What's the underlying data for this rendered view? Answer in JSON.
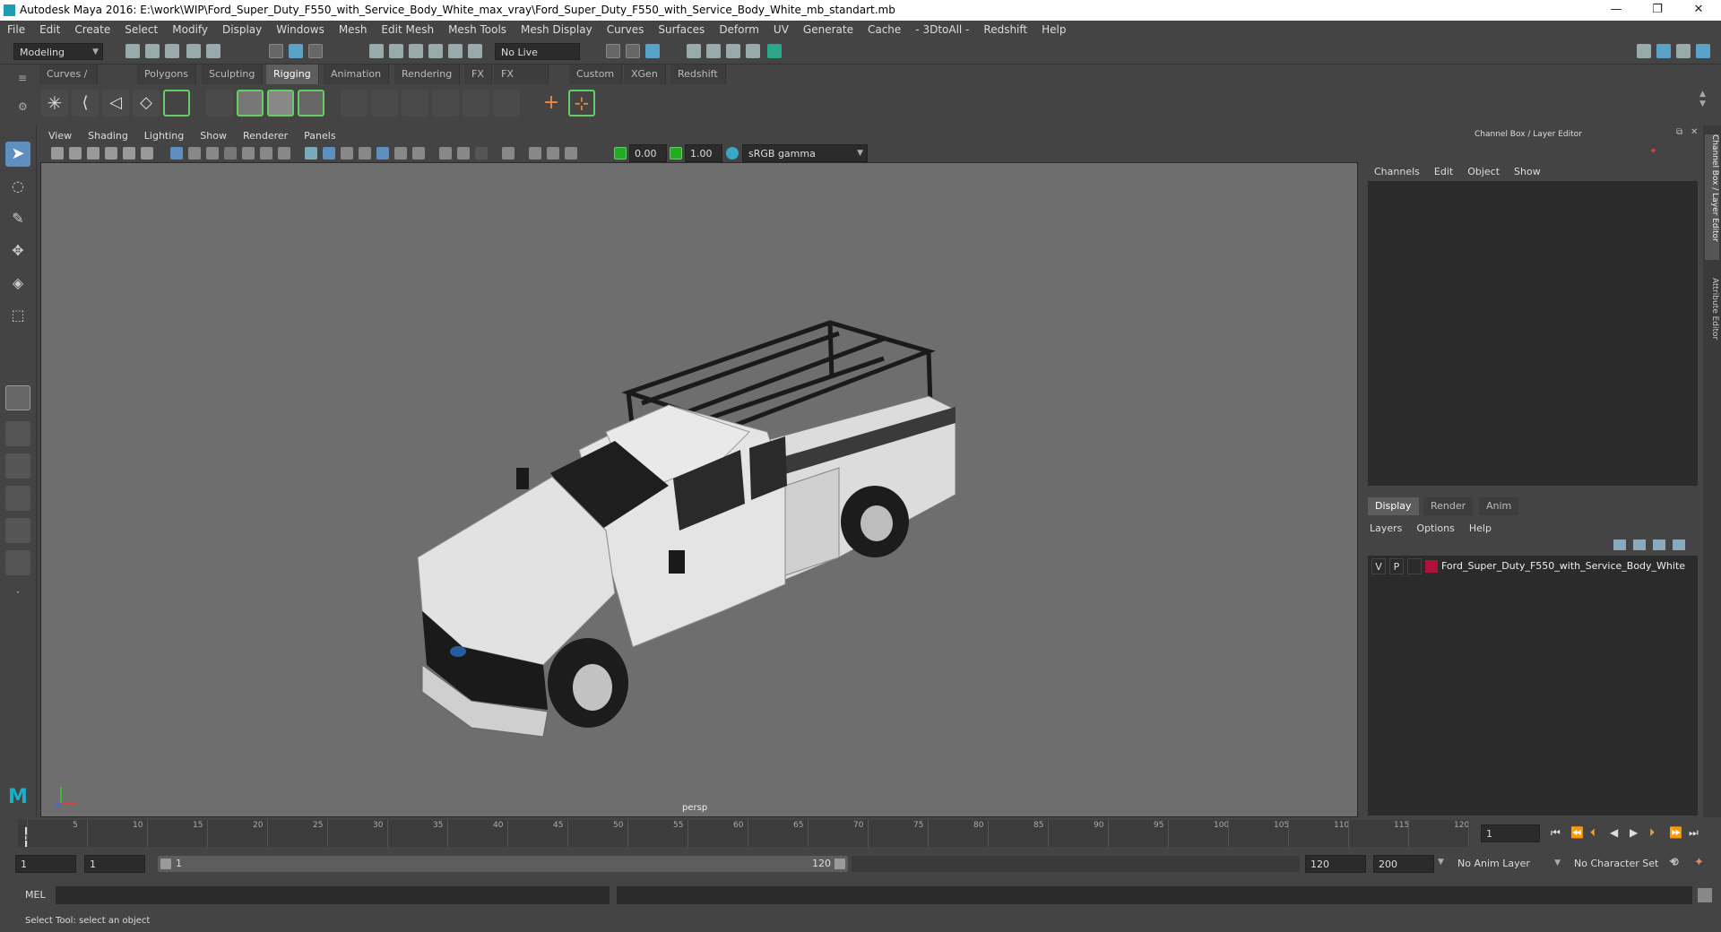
{
  "window": {
    "title": "Autodesk Maya 2016: E:\\work\\WIP\\Ford_Super_Duty_F550_with_Service_Body_White_max_vray\\Ford_Super_Duty_F550_with_Service_Body_White_mb_standart.mb",
    "minimize": "—",
    "restore": "❐",
    "close": "✕"
  },
  "menubar": [
    "File",
    "Edit",
    "Create",
    "Select",
    "Modify",
    "Display",
    "Windows",
    "Mesh",
    "Edit Mesh",
    "Mesh Tools",
    "Mesh Display",
    "Curves",
    "Surfaces",
    "Deform",
    "UV",
    "Generate",
    "Cache",
    "- 3DtoAll -",
    "Redshift",
    "Help"
  ],
  "statusline": {
    "mode": "Modeling",
    "live_surface": "No Live Surface"
  },
  "shelf_tabs": [
    "Curves / Surfaces",
    "Polygons",
    "Sculpting",
    "Rigging",
    "Animation",
    "Rendering",
    "FX",
    "FX Caching",
    "Custom",
    "XGen",
    "Redshift"
  ],
  "shelf_active": "Rigging",
  "viewport": {
    "menu": [
      "View",
      "Shading",
      "Lighting",
      "Show",
      "Renderer",
      "Panels"
    ],
    "exposure": "0.00",
    "gamma": "1.00",
    "color_space": "sRGB gamma",
    "camera_label": "persp"
  },
  "channel_box": {
    "title": "Channel Box / Layer Editor",
    "menu": [
      "Channels",
      "Edit",
      "Object",
      "Show"
    ]
  },
  "layer_editor": {
    "tabs": [
      "Display",
      "Render",
      "Anim"
    ],
    "active_tab": "Display",
    "menu": [
      "Layers",
      "Options",
      "Help"
    ],
    "layers": [
      {
        "v": "V",
        "p": "P",
        "name": "Ford_Super_Duty_F550_with_Service_Body_White",
        "color": "#b0103a"
      }
    ]
  },
  "side_tabs": [
    "Channel Box / Layer Editor",
    "Attribute Editor"
  ],
  "timeline": {
    "ticks": [
      "1",
      "5",
      "10",
      "15",
      "20",
      "25",
      "30",
      "35",
      "40",
      "45",
      "50",
      "55",
      "60",
      "65",
      "70",
      "75",
      "80",
      "85",
      "90",
      "95",
      "100",
      "105",
      "110",
      "115",
      "120"
    ],
    "current_frame": "1"
  },
  "range": {
    "start": "1",
    "playback_start": "1",
    "slider_start": "1",
    "slider_end": "120",
    "playback_end": "120",
    "end": "200",
    "anim_layer": "No Anim Layer",
    "character_set": "No Character Set"
  },
  "command_line": {
    "label": "MEL"
  },
  "help_line": "Select Tool: select an object",
  "colors": {
    "accent": "#5d5d5d",
    "viewport_bg": "#6e6e6e",
    "panel_bg": "#2b2b2b"
  }
}
